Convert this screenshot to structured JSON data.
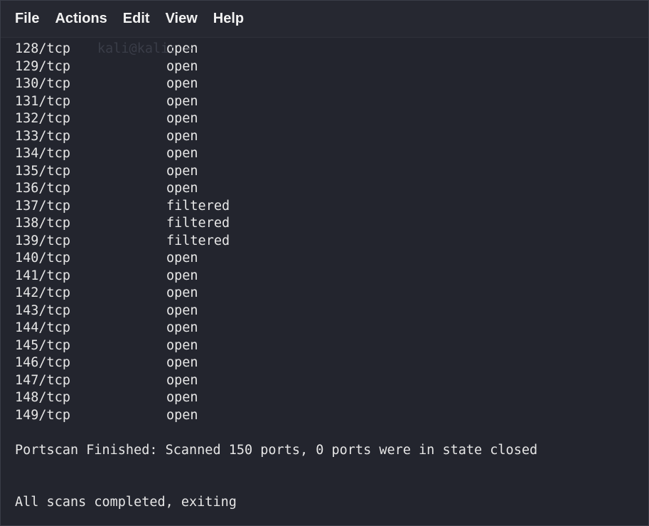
{
  "menu": {
    "items": [
      "File",
      "Actions",
      "Edit",
      "View",
      "Help"
    ]
  },
  "terminal": {
    "ghost_text": "kali@kali: ~",
    "rows": [
      {
        "port": "128/tcp",
        "state": "open"
      },
      {
        "port": "129/tcp",
        "state": "open"
      },
      {
        "port": "130/tcp",
        "state": "open"
      },
      {
        "port": "131/tcp",
        "state": "open"
      },
      {
        "port": "132/tcp",
        "state": "open"
      },
      {
        "port": "133/tcp",
        "state": "open"
      },
      {
        "port": "134/tcp",
        "state": "open"
      },
      {
        "port": "135/tcp",
        "state": "open"
      },
      {
        "port": "136/tcp",
        "state": "open"
      },
      {
        "port": "137/tcp",
        "state": "filtered"
      },
      {
        "port": "138/tcp",
        "state": "filtered"
      },
      {
        "port": "139/tcp",
        "state": "filtered"
      },
      {
        "port": "140/tcp",
        "state": "open"
      },
      {
        "port": "141/tcp",
        "state": "open"
      },
      {
        "port": "142/tcp",
        "state": "open"
      },
      {
        "port": "143/tcp",
        "state": "open"
      },
      {
        "port": "144/tcp",
        "state": "open"
      },
      {
        "port": "145/tcp",
        "state": "open"
      },
      {
        "port": "146/tcp",
        "state": "open"
      },
      {
        "port": "147/tcp",
        "state": "open"
      },
      {
        "port": "148/tcp",
        "state": "open"
      },
      {
        "port": "149/tcp",
        "state": "open"
      }
    ],
    "summary_line": "Portscan Finished: Scanned 150 ports, 0 ports were in state closed",
    "final_line": "All scans completed, exiting"
  },
  "colors": {
    "background": "#23252e",
    "text": "#e6e6e6",
    "menu_text": "#f2f2f2"
  }
}
